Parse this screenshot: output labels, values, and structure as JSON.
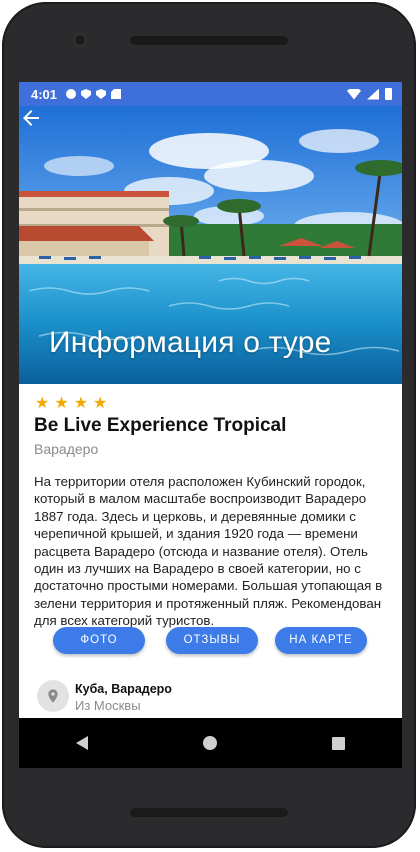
{
  "status_bar": {
    "time": "4:01",
    "left_icons": [
      "gear-icon",
      "shield-icon",
      "shield-icon",
      "sd-card-icon"
    ],
    "right_icons": [
      "wifi-icon",
      "signal-icon",
      "battery-icon"
    ],
    "color": "#3f6fd8"
  },
  "header": {
    "back_icon": "arrow-left-icon",
    "title": "Информация о туре"
  },
  "hotel": {
    "stars": 4,
    "star_glyph": "★",
    "name": "Be Live Experience Tropical",
    "city": "Варадеро",
    "description": "На территории отеля расположен Кубинский городок, который в малом масштабе воспроизводит Варадеро 1887 года. Здесь и церковь, и деревянные домики с черепичной крышей, и здания 1920 года — времени расцвета Варадеро (отсюда и название отеля). Отель один из лучших на Варадеро в своей категории, но с достаточно простыми номерами. Большая утопающая в зелени территория и протяженный пляж. Рекомендован для всех категорий туристов."
  },
  "actions": {
    "photo": "ФОТО",
    "reviews": "ОТЗЫВЫ",
    "on_map": "НА КАРТЕ",
    "accent": "#3d7ce8"
  },
  "location": {
    "icon": "map-pin-icon",
    "title": "Куба, Варадеро",
    "subtitle": "Из Москвы"
  },
  "system_nav": {
    "back": "nav-back-icon",
    "home": "nav-home-icon",
    "recents": "nav-recents-icon"
  }
}
